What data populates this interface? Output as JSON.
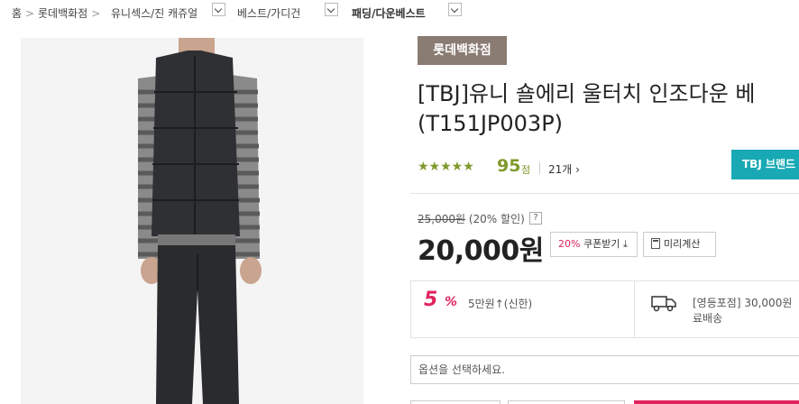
{
  "breadcrumb": {
    "home": "홈",
    "items": [
      "롯데백화점",
      "유니섹스/진 캐쥬얼",
      "베스트/가디건",
      "패딩/다운베스트"
    ]
  },
  "product": {
    "brand_badge": "롯데백화점",
    "title_line1": "[TBJ]유니 숄에리 울터치 인조다운 베",
    "title_line2": "(T151JP003P)",
    "rating_stars": "★★★★★",
    "rating_value": 4.5,
    "score": "95",
    "score_unit": "점",
    "review_count": "21개",
    "brand_button": "TBJ 브랜드"
  },
  "pricing": {
    "original_price": "25,000원",
    "discount": "(20% 할인)",
    "help": "?",
    "price": "20,000원",
    "coupon_pct": "20%",
    "coupon_label": "쿠폰받기",
    "calc_label": "미리계산"
  },
  "benefits": {
    "card_pct": "5",
    "card_pct_sign": "%",
    "card_text": "5만원↑(신한)",
    "shipping_line1": "[영등포점] 30,000원",
    "shipping_line2": "료배송"
  },
  "options": {
    "placeholder": "옵션을 선택하세요."
  },
  "colors": {
    "brand_badge": "#8a7b73",
    "accent_green": "#7f9a2b",
    "brand_button": "#18a9b4",
    "accent_pink": "#e0245e"
  }
}
